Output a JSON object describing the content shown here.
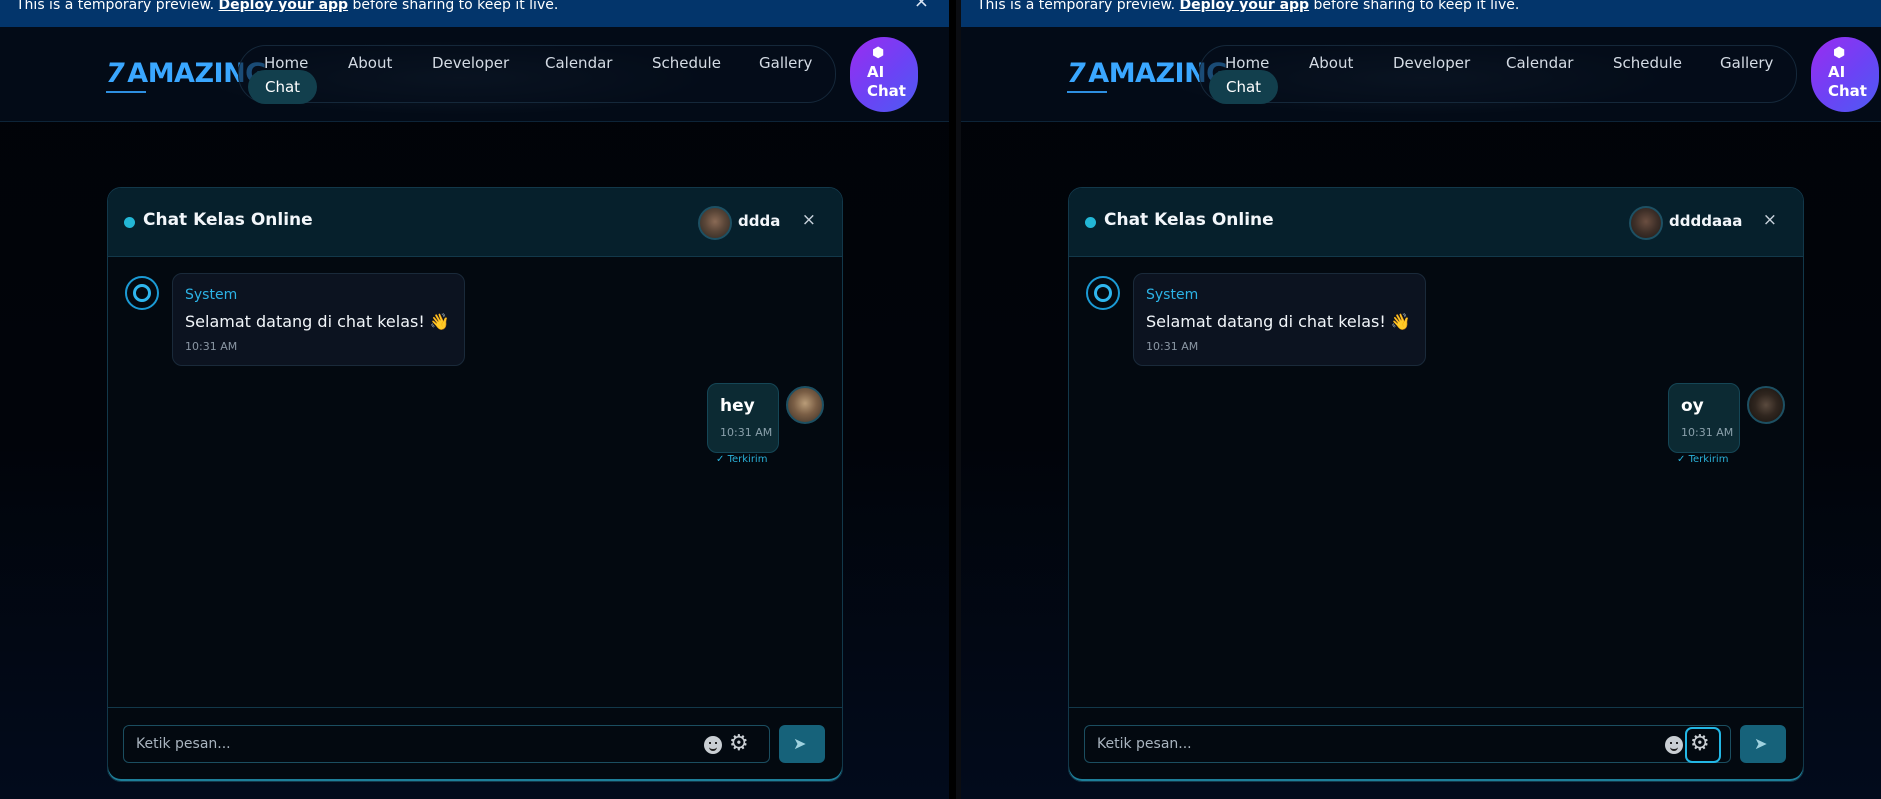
{
  "banner": {
    "prefix": "This is a temporary preview.",
    "link": "Deploy your app",
    "suffix": "before sharing to keep it live.",
    "close": "×"
  },
  "nav": {
    "logo_num": "7",
    "logo_text": "AMAZING",
    "links": [
      "Home",
      "About",
      "Developer",
      "Calendar",
      "Schedule",
      "Gallery"
    ],
    "active": "Chat",
    "ai_line1": "AI",
    "ai_line2": "Chat"
  },
  "chat": {
    "title": "Chat Kelas Online",
    "close": "×",
    "system_name": "System",
    "system_text": "Selamat datang di chat kelas! 👋",
    "system_time": "10:31 AM",
    "status": "Terkirim",
    "placeholder": "Ketik pesan..."
  },
  "panes": [
    {
      "username": "ddda",
      "my_message": "hey",
      "my_time": "10:31 AM",
      "gear_active": false
    },
    {
      "username": "ddddaaa",
      "my_message": "oy",
      "my_time": "10:31 AM",
      "gear_active": true
    }
  ],
  "colors": {
    "accent": "#23b7d6",
    "logo": "#3aa7ff",
    "banner": "#03356b",
    "ai_gradient_start": "#9b2cf0",
    "ai_gradient_end": "#4d5cf2"
  },
  "icons": [
    "robot-icon",
    "close-icon",
    "emoji-icon",
    "gear-icon",
    "send-icon",
    "double-check-icon"
  ]
}
